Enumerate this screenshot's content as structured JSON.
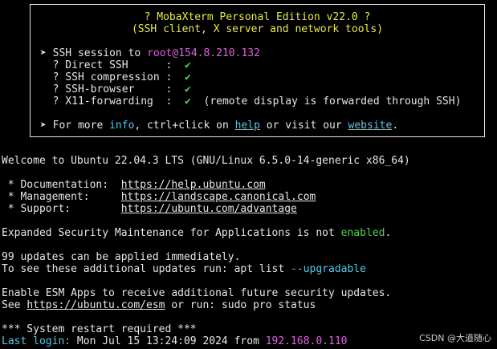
{
  "banner": {
    "title": "? MobaXterm Personal Edition v22.0 ?",
    "subtitle": "(SSH client, X server and network tools)",
    "session_prefix": "➤ SSH session to ",
    "session_host": "root@154.8.210.132",
    "features": [
      {
        "label": "  ? Direct SSH      :  ",
        "check": "✔",
        "note": ""
      },
      {
        "label": "  ? SSH compression :  ",
        "check": "✔",
        "note": ""
      },
      {
        "label": "  ? SSH-browser     :  ",
        "check": "✔",
        "note": ""
      },
      {
        "label": "  ? X11-forwarding  :  ",
        "check": "✔",
        "note": "  (remote display is forwarded through SSH)"
      }
    ],
    "more_prefix": "➤ For more ",
    "more_info": "info",
    "more_mid": ", ctrl+click on ",
    "more_help": "help",
    "more_or": " or visit our ",
    "more_website": "website",
    "more_end": "."
  },
  "terminal": {
    "welcome": "Welcome to Ubuntu 22.04.3 LTS (GNU/Linux 6.5.0-14-generic x86_64)",
    "doc_label": " * Documentation:  ",
    "doc_url": "https://help.ubuntu.com",
    "mgmt_label": " * Management:     ",
    "mgmt_url": "https://landscape.canonical.com",
    "support_label": " * Support:        ",
    "support_url": "https://ubuntu.com/advantage",
    "esm_prefix": "Expanded Security Maintenance for Applications is not ",
    "esm_status": "enabled",
    "esm_end": ".",
    "updates_line1": "99 updates can be applied immediately.",
    "updates_line2_prefix": "To see these additional updates run: apt list ",
    "updates_line2_flag": "--upgradable",
    "esm_apps_line1": "Enable ESM Apps to receive additional future security updates.",
    "esm_apps_prefix": "See ",
    "esm_apps_url": "https://ubuntu.com/esm",
    "esm_apps_suffix": " or run: sudo pro status",
    "restart": "*** System restart required ***",
    "last_login_label": "Last login:",
    "last_login_text": " Mon Jul 15 13:24:09 2024 from ",
    "last_login_ip": "192.168.0.110"
  },
  "watermark": "CSDN @大道随心",
  "colors": {
    "background": "#000000",
    "yellow": "#e8e84a",
    "magenta": "#e060e0",
    "green": "#4fd04f",
    "cyan": "#54c8e8"
  }
}
